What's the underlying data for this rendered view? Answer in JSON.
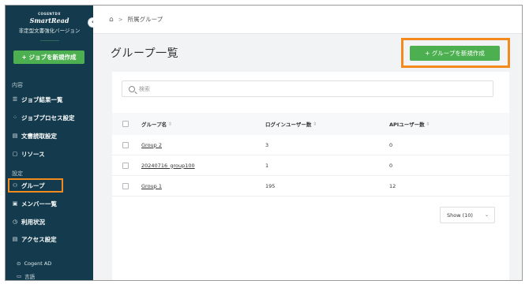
{
  "brand": {
    "company": "COGENT",
    "company_mark": "DX",
    "product": "SmartRead",
    "subtitle": "非定型文書強化バージョン"
  },
  "sidebar": {
    "collapse_icon": "chevron-left-icon",
    "new_job_label": "+ ジョブを新規作成",
    "section_content": "内容",
    "section_settings": "設定",
    "content_items": [
      {
        "icon": "list-icon",
        "label": "ジョブ結果一覧"
      },
      {
        "icon": "process-icon",
        "label": "ジョブプロセス設定"
      },
      {
        "icon": "document-icon",
        "label": "文書読取設定"
      },
      {
        "icon": "folder-icon",
        "label": "リソース"
      }
    ],
    "settings_items": [
      {
        "icon": "group-icon",
        "label": "グループ",
        "active": true
      },
      {
        "icon": "id-card-icon",
        "label": "メンバー一覧"
      },
      {
        "icon": "usage-icon",
        "label": "利用状況"
      },
      {
        "icon": "access-icon",
        "label": "アクセス設定"
      }
    ],
    "footer": {
      "account": "Cogent AD",
      "language": "言語"
    }
  },
  "topbar": {
    "breadcrumb_sep": ">",
    "breadcrumb": "所属グループ"
  },
  "page": {
    "title": "グループ一覧",
    "create_button": "+ グループを新規作成",
    "highlight_color": "#f28a1e",
    "accent_color": "#4caf50"
  },
  "search": {
    "placeholder": "検索"
  },
  "table": {
    "headers": {
      "name": "グループ名",
      "login_users": "ログインユーザー数",
      "api_users": "APIユーザー数"
    },
    "rows": [
      {
        "name": "Group 2",
        "login_users": "3",
        "api_users": "0"
      },
      {
        "name": "20240716_group100",
        "login_users": "1",
        "api_users": "0"
      },
      {
        "name": "Group 1",
        "login_users": "195",
        "api_users": "12"
      }
    ]
  },
  "pagination": {
    "show_label": "Show (10)"
  }
}
